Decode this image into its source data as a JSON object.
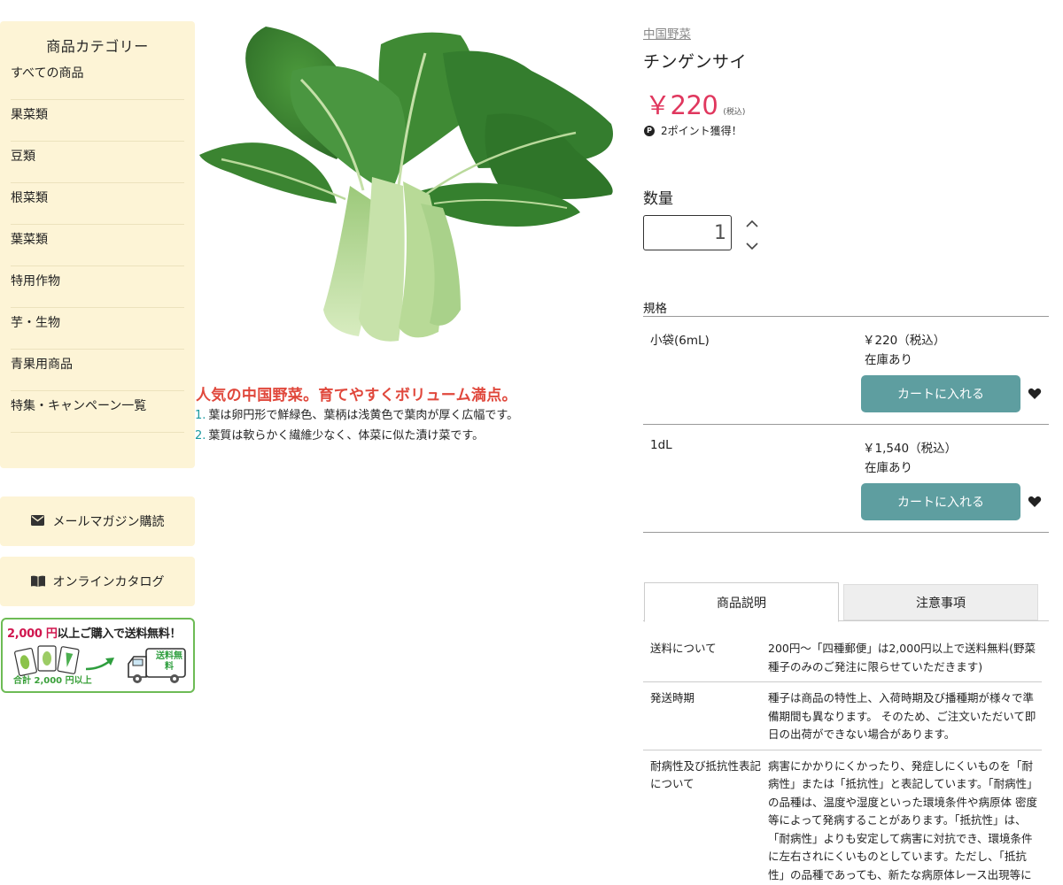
{
  "sidebar": {
    "title": "商品カテゴリー",
    "items": [
      {
        "label": "すべての商品"
      },
      {
        "label": "果菜類"
      },
      {
        "label": "豆類"
      },
      {
        "label": "根菜類"
      },
      {
        "label": "葉菜類"
      },
      {
        "label": "特用作物"
      },
      {
        "label": "芋・生物"
      },
      {
        "label": "青果用商品"
      },
      {
        "label": "特集・キャンペーン一覧"
      }
    ],
    "mail_magazine": {
      "label": "メールマガジン購読",
      "icon": "envelope-icon"
    },
    "online_catalog": {
      "label": "オンラインカタログ",
      "icon": "book-icon"
    },
    "banner": {
      "amount": "2,000 円",
      "text": "以上ご購入で送料無料！",
      "sub": "合計 2,000 円以上",
      "truck_text": "送料無料",
      "accent": "#d0164e",
      "border": "#6dbb55"
    }
  },
  "product": {
    "category_link": "中国野菜",
    "name": "チンゲンサイ",
    "price": "￥220",
    "tax_note": "(税込)",
    "points": "2ポイント獲得！",
    "points_badge": "P",
    "catch_copy": "人気の中国野菜。育てやすくボリューム満点。",
    "features": [
      {
        "num": "1.",
        "text": "葉は卵円形で鮮緑色、葉柄は浅黄色で葉肉が厚く広幅です。"
      },
      {
        "num": "2.",
        "text": "葉質は軟らかく繊維少なく、体菜に似た漬け菜です。"
      }
    ],
    "price_color": "#e0375e",
    "catch_color": "#e0483c"
  },
  "quantity": {
    "label": "数量",
    "value": "1"
  },
  "specs": {
    "label": "規格",
    "rows": [
      {
        "name": "小袋(6mL)",
        "price": "￥220（税込）",
        "stock": "在庫あり",
        "cart_label": "カートに入れる"
      },
      {
        "name": "1dL",
        "price": "￥1,540（税込）",
        "stock": "在庫あり",
        "cart_label": "カートに入れる"
      }
    ],
    "button_color": "#5e9ea0"
  },
  "tabs": {
    "description": "商品説明",
    "notes": "注意事項"
  },
  "info": [
    {
      "key": "送料について",
      "value": "200円〜「四種郵便」は2,000円以上で送料無料(野菜種子のみのご発注に限らせていただきます)"
    },
    {
      "key": "発送時期",
      "value": "種子は商品の特性上、入荷時期及び播種期が様々で準備期間も異なります。 そのため、ご注文いただいて即日の出荷ができない場合があります。"
    },
    {
      "key": "耐病性及び抵抗性表記について",
      "value": "病害にかかりにくかったり、発症しにくいものを「耐病性」または「抵抗性」と表記しています。「耐病性」の品種は、温度や湿度といった環境条件や病原体 密度等によって発病することがあります。「抵抗性」は、「耐病性」よりも安定して病害に対抗でき、環境条件に左右されにくいものとしています。ただし、「抵抗性」の品種であっても、新たな病原体レース出現等によっては発病する可能性があります。"
    }
  ]
}
